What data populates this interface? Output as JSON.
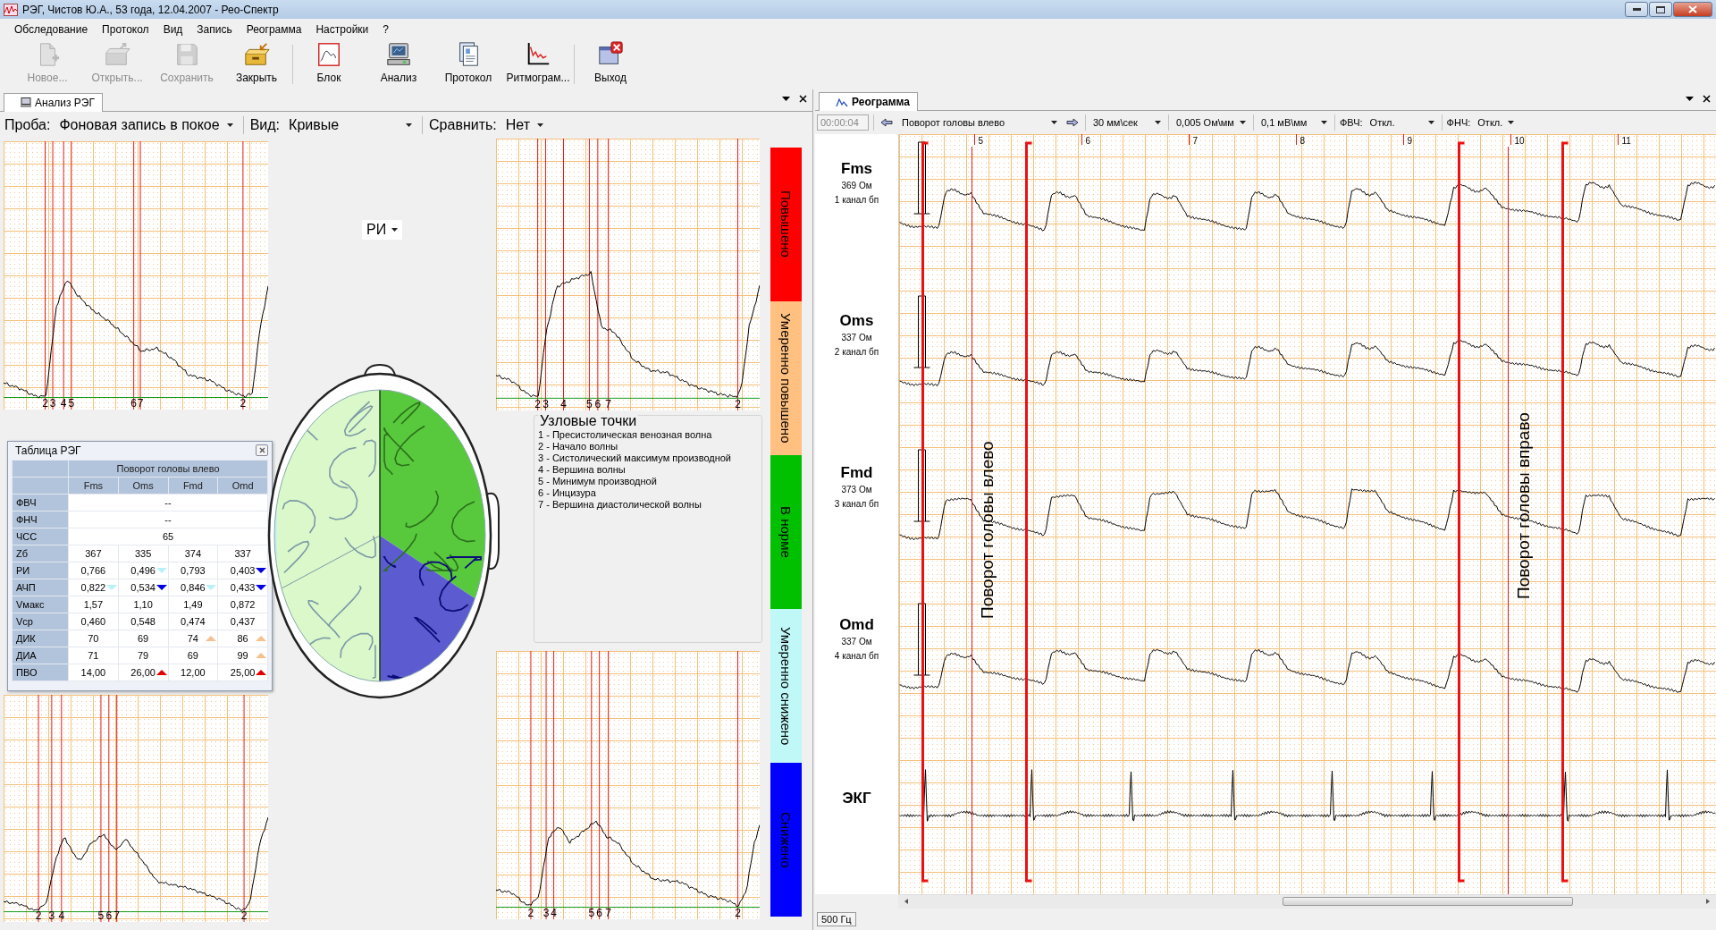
{
  "window": {
    "title": "РЭГ, Чистов Ю.А., 53 года, 12.04.2007 - Рео-Спектр"
  },
  "menu": [
    "Обследование",
    "Протокол",
    "Вид",
    "Запись",
    "Реограмма",
    "Настройки",
    "?"
  ],
  "toolbar": [
    {
      "label": "Новое...",
      "kind": "new",
      "disabled": true
    },
    {
      "label": "Открыть...",
      "kind": "open",
      "disabled": true
    },
    {
      "label": "Сохранить",
      "kind": "save",
      "disabled": true
    },
    {
      "label": "Закрыть",
      "kind": "close",
      "disabled": false
    },
    {
      "label": "Блок",
      "kind": "block",
      "disabled": false
    },
    {
      "label": "Анализ",
      "kind": "analysis",
      "disabled": false
    },
    {
      "label": "Протокол",
      "kind": "protocol",
      "disabled": false
    },
    {
      "label": "Ритмограм...",
      "kind": "rhythm",
      "disabled": false
    },
    {
      "label": "Выход",
      "kind": "exit",
      "disabled": false
    }
  ],
  "analysis_panel": {
    "tab": "Анализ РЭГ",
    "controls": [
      {
        "label": "Проба:",
        "value": "Фоновая запись в покое"
      },
      {
        "label": "Вид:",
        "value": "Кривые"
      },
      {
        "label": "Сравнить:",
        "value": "Нет"
      }
    ],
    "index_selector": "РИ",
    "curves": [
      {
        "points": [
          "2",
          "3",
          "4",
          "5",
          "6",
          "7",
          "2"
        ]
      },
      {
        "points": [
          "2",
          "3",
          "4",
          "5",
          "6",
          "7",
          "2"
        ]
      },
      {
        "points": [
          "2",
          "3",
          "4",
          "5",
          "6",
          "7",
          "2"
        ]
      },
      {
        "points": [
          "2",
          "3",
          "4",
          "5",
          "6",
          "7",
          "2"
        ]
      }
    ],
    "table": {
      "title": "Таблица РЭГ",
      "group_header": "Поворот головы влево",
      "columns": [
        "Fms",
        "Oms",
        "Fmd",
        "Omd"
      ],
      "rows": [
        {
          "label": "ФВЧ",
          "merged": "--"
        },
        {
          "label": "ФНЧ",
          "merged": "--"
        },
        {
          "label": "ЧСС",
          "merged": "65"
        },
        {
          "label": "Zб",
          "cells": [
            {
              "value": "367"
            },
            {
              "value": "335"
            },
            {
              "value": "374"
            },
            {
              "value": "337"
            }
          ]
        },
        {
          "label": "РИ",
          "cells": [
            {
              "value": "0,766"
            },
            {
              "value": "0,496",
              "kind": "down",
              "color": "#b8f2f8"
            },
            {
              "value": "0,793"
            },
            {
              "value": "0,403",
              "kind": "down",
              "color": "#0000e0"
            }
          ]
        },
        {
          "label": "АЧП",
          "cells": [
            {
              "value": "0,822",
              "kind": "down",
              "color": "#b8f2f8"
            },
            {
              "value": "0,534",
              "kind": "down",
              "color": "#0000e0"
            },
            {
              "value": "0,846",
              "kind": "down",
              "color": "#b8f2f8"
            },
            {
              "value": "0,433",
              "kind": "down",
              "color": "#0000e0"
            }
          ]
        },
        {
          "label": "Vмакс",
          "cells": [
            {
              "value": "1,57"
            },
            {
              "value": "1,10"
            },
            {
              "value": "1,49"
            },
            {
              "value": "0,872"
            }
          ]
        },
        {
          "label": "Vср",
          "cells": [
            {
              "value": "0,460"
            },
            {
              "value": "0,548"
            },
            {
              "value": "0,474"
            },
            {
              "value": "0,437"
            }
          ]
        },
        {
          "label": "ДИК",
          "cells": [
            {
              "value": "70"
            },
            {
              "value": "69"
            },
            {
              "value": "74",
              "kind": "up",
              "color": "#f8c08c"
            },
            {
              "value": "86",
              "kind": "up",
              "color": "#f8c08c"
            }
          ]
        },
        {
          "label": "ДИА",
          "cells": [
            {
              "value": "71"
            },
            {
              "value": "79"
            },
            {
              "value": "69"
            },
            {
              "value": "99",
              "kind": "up",
              "color": "#f8c08c"
            }
          ]
        },
        {
          "label": "ПВО",
          "cells": [
            {
              "value": "14,00"
            },
            {
              "value": "26,00",
              "kind": "up",
              "color": "#e00000"
            },
            {
              "value": "12,00"
            },
            {
              "value": "25,00",
              "kind": "up",
              "color": "#e00000"
            }
          ]
        }
      ]
    },
    "legend": {
      "title": "Узловые точки",
      "items": [
        "1 - Пресистолическая венозная волна",
        "2 - Начало волны",
        "3 - Систолический максимум производной",
        "4 - Вершина волны",
        "5 - Минимум производной",
        "6 - Инцизура",
        "7 - Вершина диастолической волны"
      ]
    },
    "scale": [
      {
        "label": "Повышено",
        "color": "#ff0000"
      },
      {
        "label": "Умеренно повышено",
        "color": "#ffc080"
      },
      {
        "label": "В норме",
        "color": "#00c000"
      },
      {
        "label": "Умеренно снижено",
        "color": "#c0f8f8"
      },
      {
        "label": "Снижено",
        "color": "#0000ff"
      }
    ]
  },
  "reogram_panel": {
    "tab": "Реограмма",
    "time": "00:00:04",
    "event": "Поворот головы влево",
    "speed": "30 мм\\сек",
    "ohm_scale": "0,005 Ом\\мм",
    "mv_scale": "0,1 мВ\\мм",
    "filters": [
      {
        "label": "ФВЧ:",
        "value": "Откл."
      },
      {
        "label": "ФНЧ:",
        "value": "Откл."
      }
    ],
    "seconds": [
      "5",
      "6",
      "7",
      "8",
      "9",
      "10",
      "11"
    ],
    "channels": [
      {
        "name": "Fms",
        "impedance": "369 Ом",
        "channel": "1 канал бп"
      },
      {
        "name": "Oms",
        "impedance": "337 Ом",
        "channel": "2 канал бп"
      },
      {
        "name": "Fmd",
        "impedance": "373 Ом",
        "channel": "3 канал бп"
      },
      {
        "name": "Omd",
        "impedance": "337 Ом",
        "channel": "4 канал бп"
      },
      {
        "name": "ЭКГ"
      }
    ],
    "markers": [
      {
        "label": "Поворот головы влево"
      },
      {
        "label": "Поворот головы вправо"
      }
    ],
    "sample_rate": "500 Гц"
  }
}
